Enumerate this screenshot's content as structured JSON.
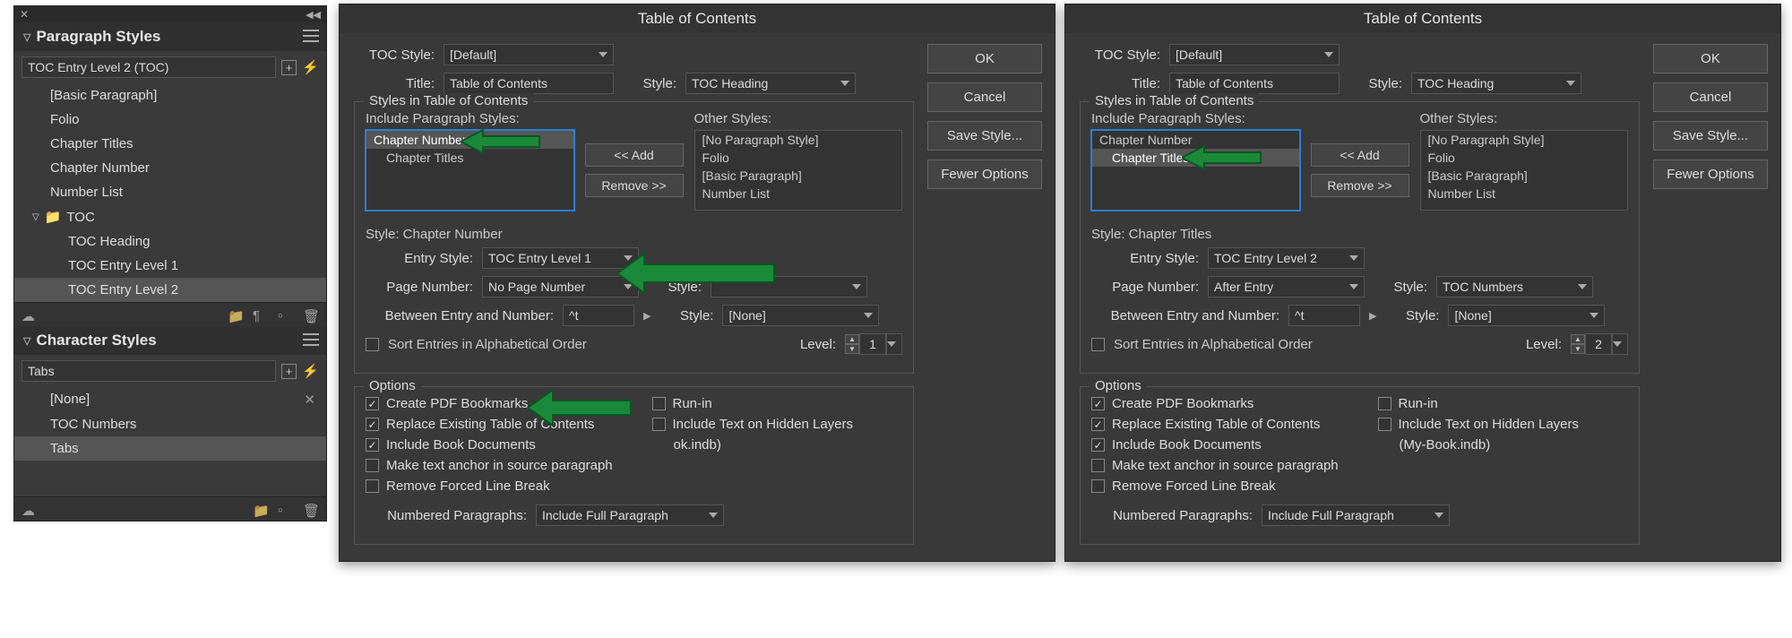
{
  "panels": {
    "para_title": "Paragraph Styles",
    "char_title": "Character Styles",
    "selected_style": "TOC Entry Level 2 (TOC)",
    "para_items": [
      "[Basic Paragraph]",
      "Folio",
      "Chapter Titles",
      "Chapter Number",
      "Number List"
    ],
    "toc_folder": "TOC",
    "toc_items": [
      "TOC Heading",
      "TOC Entry Level 1",
      "TOC Entry Level 2"
    ],
    "char_selected": "Tabs",
    "char_items": [
      "[None]",
      "TOC Numbers",
      "Tabs"
    ]
  },
  "dlg1": {
    "title": "Table of Contents",
    "buttons": {
      "ok": "OK",
      "cancel": "Cancel",
      "save": "Save Style...",
      "fewer": "Fewer Options"
    },
    "toc_style_lbl": "TOC Style:",
    "toc_style": "[Default]",
    "title_lbl": "Title:",
    "title_val": "Table of Contents",
    "style_lbl": "Style:",
    "style_val": "TOC Heading",
    "styles_group": "Styles in Table of Contents",
    "include_lbl": "Include Paragraph Styles:",
    "other_lbl": "Other Styles:",
    "included": [
      "Chapter Number",
      "Chapter Titles"
    ],
    "others": [
      "[No Paragraph Style]",
      "Folio",
      "[Basic Paragraph]",
      "Number List"
    ],
    "add_btn": "<< Add",
    "remove_btn": "Remove >>",
    "style_section": "Style: Chapter Number",
    "entry_style_lbl": "Entry Style:",
    "entry_style": "TOC Entry Level 1",
    "page_lbl": "Page Number:",
    "page_val": "No Page Number",
    "pn_style_lbl": "Style:",
    "pn_style_val": "",
    "between_lbl": "Between Entry and Number:",
    "between_val": "^t",
    "be_style_lbl": "Style:",
    "be_style_val": "[None]",
    "sort_lbl": "Sort Entries in Alphabetical Order",
    "level_lbl": "Level:",
    "level_val": "1",
    "options_title": "Options",
    "opt_pdf": "Create PDF Bookmarks",
    "opt_replace": "Replace Existing Table of Contents",
    "opt_book": "Include Book Documents",
    "opt_anchor": "Make text anchor in source paragraph",
    "opt_remove": "Remove Forced Line Break",
    "opt_runin": "Run-in",
    "opt_hidden": "Include Text on Hidden Layers",
    "book_file": "ok.indb)",
    "num_para_lbl": "Numbered Paragraphs:",
    "num_para_val": "Include Full Paragraph"
  },
  "dlg2": {
    "title": "Table of Contents",
    "buttons": {
      "ok": "OK",
      "cancel": "Cancel",
      "save": "Save Style...",
      "fewer": "Fewer Options"
    },
    "toc_style_lbl": "TOC Style:",
    "toc_style": "[Default]",
    "title_lbl": "Title:",
    "title_val": "Table of Contents",
    "style_lbl": "Style:",
    "style_val": "TOC Heading",
    "styles_group": "Styles in Table of Contents",
    "include_lbl": "Include Paragraph Styles:",
    "other_lbl": "Other Styles:",
    "included": [
      "Chapter Number",
      "Chapter Titles"
    ],
    "others": [
      "[No Paragraph Style]",
      "Folio",
      "[Basic Paragraph]",
      "Number List"
    ],
    "add_btn": "<< Add",
    "remove_btn": "Remove >>",
    "style_section": "Style: Chapter Titles",
    "entry_style_lbl": "Entry Style:",
    "entry_style": "TOC Entry Level 2",
    "page_lbl": "Page Number:",
    "page_val": "After Entry",
    "pn_style_lbl": "Style:",
    "pn_style_val": "TOC Numbers",
    "between_lbl": "Between Entry and Number:",
    "between_val": "^t",
    "be_style_lbl": "Style:",
    "be_style_val": "[None]",
    "sort_lbl": "Sort Entries in Alphabetical Order",
    "level_lbl": "Level:",
    "level_val": "2",
    "options_title": "Options",
    "opt_pdf": "Create PDF Bookmarks",
    "opt_replace": "Replace Existing Table of Contents",
    "opt_book": "Include Book Documents",
    "opt_anchor": "Make text anchor in source paragraph",
    "opt_remove": "Remove Forced Line Break",
    "opt_runin": "Run-in",
    "opt_hidden": "Include Text on Hidden Layers",
    "book_file": "(My-Book.indb)",
    "num_para_lbl": "Numbered Paragraphs:",
    "num_para_val": "Include Full Paragraph"
  }
}
